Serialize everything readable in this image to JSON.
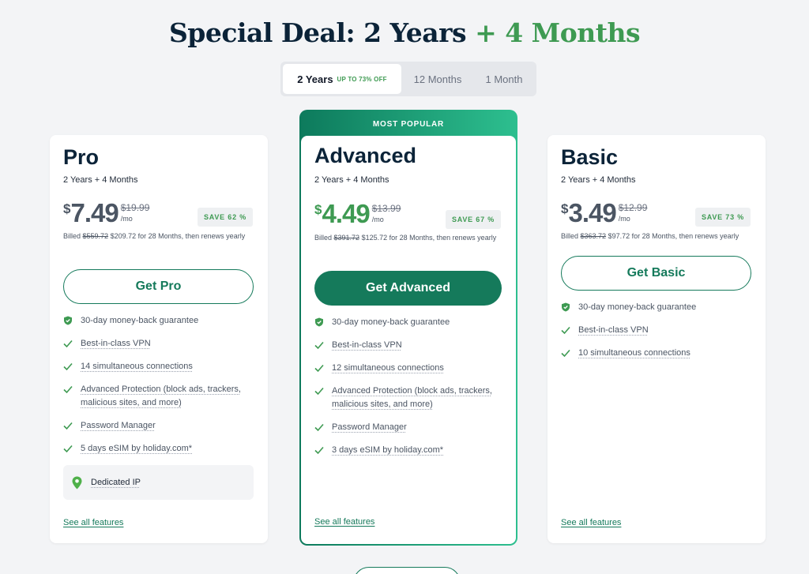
{
  "header": {
    "title_main": "Special Deal: 2 Years",
    "title_accent": "+ 4 Months"
  },
  "billing_switch": {
    "options": [
      {
        "label": "2 Years",
        "tag": "UP TO 73% OFF",
        "active": true
      },
      {
        "label": "12 Months",
        "tag": "",
        "active": false
      },
      {
        "label": "1 Month",
        "tag": "",
        "active": false
      }
    ]
  },
  "plans": {
    "pro": {
      "name": "Pro",
      "term": "2 Years + 4 Months",
      "currency": "$",
      "price": "7.49",
      "old_price": "$19.99",
      "per": "/mo",
      "save": "SAVE 62 %",
      "billed_prefix": "Billed",
      "billed_old": "$559.72",
      "billed_rest": "$209.72 for 28 Months, then renews yearly",
      "cta": "Get Pro",
      "features": [
        "30-day money-back guarantee",
        "Best-in-class VPN",
        "14 simultaneous connections",
        "Advanced Protection (block ads, trackers, malicious sites, and more)",
        "Password Manager",
        "5 days eSIM by holiday.com*"
      ],
      "addon": "Dedicated IP",
      "see_all": "See all features"
    },
    "advanced": {
      "ribbon": "MOST POPULAR",
      "name": "Advanced",
      "term": "2 Years + 4 Months",
      "currency": "$",
      "price": "4.49",
      "old_price": "$13.99",
      "per": "/mo",
      "save": "SAVE 67 %",
      "billed_prefix": "Billed",
      "billed_old": "$391.72",
      "billed_rest": "$125.72 for 28 Months, then renews yearly",
      "cta": "Get Advanced",
      "features": [
        "30-day money-back guarantee",
        "Best-in-class VPN",
        "12 simultaneous connections",
        "Advanced Protection (block ads, trackers, malicious sites, and more)",
        "Password Manager",
        "3 days eSIM by holiday.com*"
      ],
      "see_all": "See all features"
    },
    "basic": {
      "name": "Basic",
      "term": "2 Years + 4 Months",
      "currency": "$",
      "price": "3.49",
      "old_price": "$12.99",
      "per": "/mo",
      "save": "SAVE 73 %",
      "billed_prefix": "Billed",
      "billed_old": "$363.72",
      "billed_rest": "$97.72 for 28 Months, then renews yearly",
      "cta": "Get Basic",
      "features": [
        "30-day money-back guarantee",
        "Best-in-class VPN",
        "10 simultaneous connections"
      ],
      "see_all": "See all features"
    }
  },
  "icons": {
    "guarantee": "shield-check-icon",
    "feature": "check-icon",
    "addon": "location-pin-icon"
  },
  "colors": {
    "brand": "#157a5b",
    "accent": "#3e9a52",
    "heading": "#0b2338"
  }
}
